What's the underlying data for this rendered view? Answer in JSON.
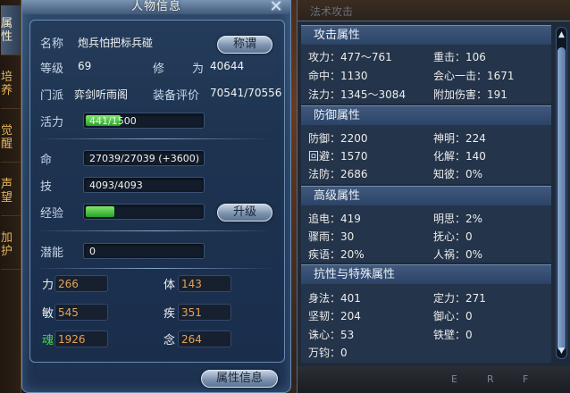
{
  "side_tabs": [
    {
      "label": "属性",
      "active": true
    },
    {
      "label": "培养",
      "active": false
    },
    {
      "label": "觉醒",
      "active": false
    },
    {
      "label": "声望",
      "active": false
    },
    {
      "label": "加护",
      "active": false
    }
  ],
  "char_panel": {
    "title": "人物信息",
    "name_label": "名称",
    "name_value": "炮兵怕把标兵碰",
    "title_button": "称谓",
    "level_label": "等级",
    "level_value": "69",
    "cultivation_label_1": "修",
    "cultivation_label_2": "为",
    "cultivation_value": "40644",
    "sect_label": "门派",
    "sect_value": "弈剑听雨阁",
    "gear_label": "装备评价",
    "gear_value": "70541/70556",
    "vitality_label": "活力",
    "vitality_value": "441/1500",
    "vitality_fraction": 0.294,
    "hp_label": "命",
    "hp_value": "27039/27039 (+3600)",
    "skill_label": "技",
    "skill_value": "4093/4093",
    "exp_label": "经验",
    "exp_fraction": 0.24,
    "upgrade_button": "升级",
    "potential_label": "潜能",
    "potential_value": "0",
    "attrs": {
      "str_label": "力",
      "str_value": "266",
      "con_label": "体",
      "con_value": "143",
      "agi_label": "敏",
      "agi_value": "545",
      "spd_label": "疾",
      "spd_value": "351",
      "soul_label": "魂",
      "soul_value": "1926",
      "mind_label": "念",
      "mind_value": "264"
    },
    "attr_info_button": "属性信息"
  },
  "attr_panel": {
    "ghost_top": "法术攻击",
    "sections": [
      {
        "title": "攻击属性",
        "rows": [
          [
            "攻力：477〜761",
            "重击：106"
          ],
          [
            "命中：1130",
            "会心一击：1671"
          ],
          [
            "法力：1345〜3084",
            "附加伤害：191"
          ]
        ]
      },
      {
        "title": "防御属性",
        "rows": [
          [
            "防御：2200",
            "神明：224"
          ],
          [
            "回避：1570",
            "化解：140"
          ],
          [
            "法防：2686",
            "知彼：0%"
          ]
        ]
      },
      {
        "title": "高级属性",
        "rows": [
          [
            "追电：419",
            "明思：2%"
          ],
          [
            "骤雨：30",
            "抚心：0"
          ],
          [
            "疾语：20%",
            "人祸：0%"
          ]
        ]
      },
      {
        "title": "抗性与特殊属性",
        "rows": [
          [
            "身法：401",
            "定力：271"
          ],
          [
            "坚韧：204",
            "御心：0"
          ],
          [
            "诛心：53",
            "铁壁：0"
          ],
          [
            "万钧：0",
            ""
          ]
        ]
      }
    ],
    "ghost_bottom": [
      "E",
      "R",
      "F"
    ]
  },
  "colors": {
    "panel_blue": "#233a57",
    "exp_green": "#28a12b",
    "attr_orange": "#e5a256",
    "soul_green": "#4fd24a"
  }
}
